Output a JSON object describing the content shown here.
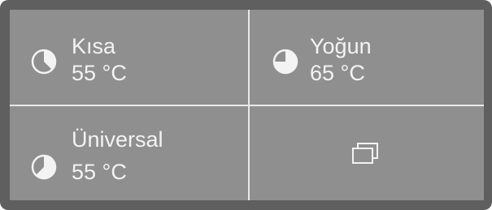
{
  "programs": [
    {
      "name": "Kısa",
      "temperature": "55 °C",
      "icon": "pie-quarter-icon"
    },
    {
      "name": "Yoğun",
      "temperature": "65 °C",
      "icon": "pie-three-quarter-icon"
    },
    {
      "name": "Üniversal",
      "temperature": "55 °C",
      "icon": "pie-half-icon"
    }
  ],
  "more": {
    "icon": "stacked-windows-icon"
  },
  "colors": {
    "frame": "#5f5f5f",
    "panel": "#8f8f8f",
    "divider": "#e9e9e9",
    "text": "#f3f3f3"
  }
}
